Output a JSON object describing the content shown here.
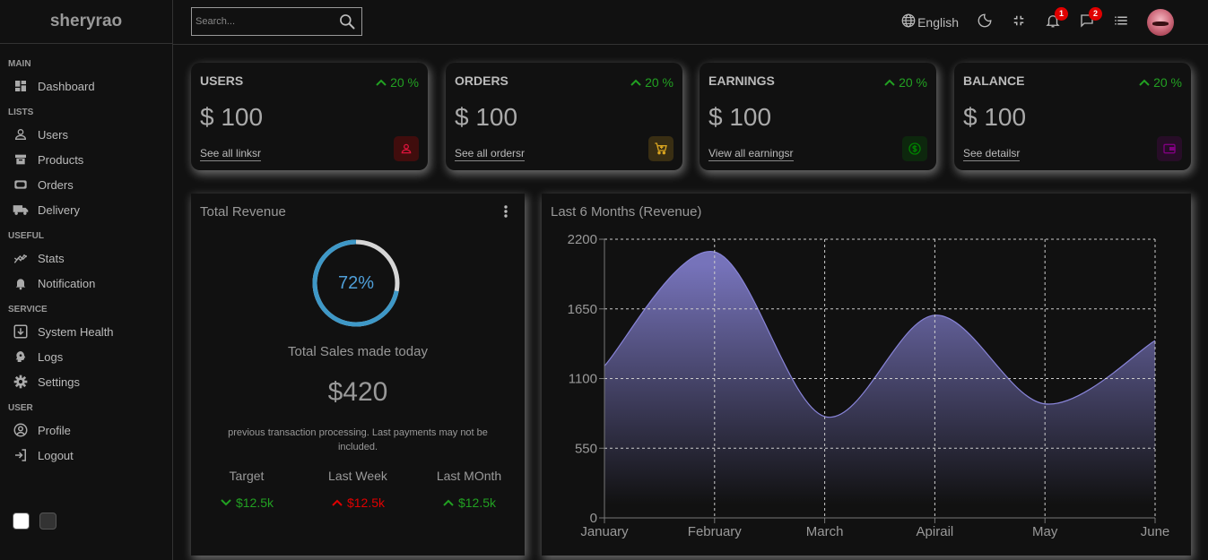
{
  "sidebar": {
    "logo": "sheryrao",
    "sections": [
      {
        "title": "MAIN",
        "items": [
          {
            "label": "Dashboard",
            "icon": "dashboard-icon"
          }
        ]
      },
      {
        "title": "LISTS",
        "items": [
          {
            "label": "Users",
            "icon": "person-icon"
          },
          {
            "label": "Products",
            "icon": "store-icon"
          },
          {
            "label": "Orders",
            "icon": "credit-card-icon"
          },
          {
            "label": "Delivery",
            "icon": "truck-icon"
          }
        ]
      },
      {
        "title": "USEFUL",
        "items": [
          {
            "label": "Stats",
            "icon": "stats-icon"
          },
          {
            "label": "Notification",
            "icon": "bell-icon"
          }
        ]
      },
      {
        "title": "SERVICE",
        "items": [
          {
            "label": "System Health",
            "icon": "system-health-icon"
          },
          {
            "label": "Logs",
            "icon": "psychology-icon"
          },
          {
            "label": "Settings",
            "icon": "gear-icon"
          }
        ]
      },
      {
        "title": "USER",
        "items": [
          {
            "label": "Profile",
            "icon": "account-circle-icon"
          },
          {
            "label": "Logout",
            "icon": "logout-icon"
          }
        ]
      }
    ],
    "themes": [
      {
        "name": "light",
        "color": "#ffffff"
      },
      {
        "name": "dark",
        "color": "#333333"
      }
    ]
  },
  "topbar": {
    "search_placeholder": "Search...",
    "language": "English",
    "notifications_count": "1",
    "messages_count": "2"
  },
  "widgets": [
    {
      "title": "USERS",
      "percent": "20 %",
      "value": "$ 100",
      "link": "See all linksr",
      "icon": "person-outline-icon",
      "icon_color": "#dc143c",
      "icon_bg": "rgba(255,0,0,0.2)"
    },
    {
      "title": "ORDERS",
      "percent": "20 %",
      "value": "$ 100",
      "link": "See all ordersr",
      "icon": "shopping-cart-icon",
      "icon_color": "#daa520",
      "icon_bg": "rgba(218,165,32,0.2)"
    },
    {
      "title": "EARNINGS",
      "percent": "20 %",
      "value": "$ 100",
      "link": "View all earningsr",
      "icon": "money-icon",
      "icon_color": "#008000",
      "icon_bg": "rgba(0,128,0,0.2)"
    },
    {
      "title": "BALANCE",
      "percent": "20 %",
      "value": "$ 100",
      "link": "See detailsr",
      "icon": "wallet-icon",
      "icon_color": "#800080",
      "icon_bg": "rgba(128,0,128,0.2)"
    }
  ],
  "featured": {
    "title": "Total Revenue",
    "progress_label": "72%",
    "progress_value": 0.72,
    "subtitle": "Total Sales made today",
    "amount": "$420",
    "description": "previous transaction processing. Last payments may not be included.",
    "summary": [
      {
        "title": "Target",
        "value": "$12.5k",
        "trend": "down",
        "color": "#22a022"
      },
      {
        "title": "Last Week",
        "value": "$12.5k",
        "trend": "up",
        "color": "#e00000"
      },
      {
        "title": "Last MOnth",
        "value": "$12.5k",
        "trend": "up",
        "color": "#22a022"
      }
    ]
  },
  "chart_data": {
    "type": "area",
    "title": "Last 6 Months (Revenue)",
    "categories": [
      "January",
      "February",
      "March",
      "Apirail",
      "May",
      "June"
    ],
    "values": [
      1200,
      2100,
      800,
      1600,
      900,
      1400
    ],
    "ylim": [
      0,
      2200
    ],
    "yticks": [
      0,
      550,
      1100,
      1650,
      2200
    ],
    "grid": true,
    "stroke_color": "#8884d8"
  }
}
